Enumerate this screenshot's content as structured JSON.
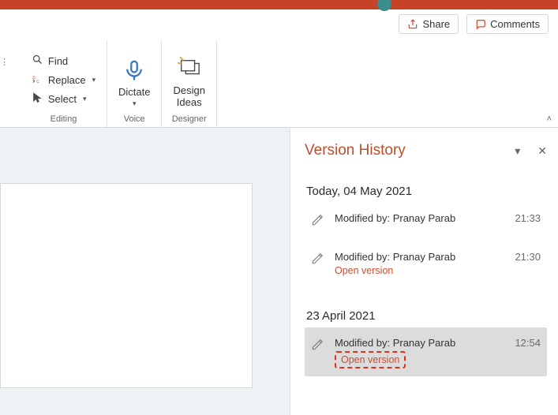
{
  "title_bar": {},
  "top_buttons": {
    "share": "Share",
    "comments": "Comments"
  },
  "ribbon": {
    "editing": {
      "label": "Editing",
      "find": "Find",
      "replace": "Replace",
      "select": "Select"
    },
    "voice": {
      "label": "Voice",
      "dictate": "Dictate"
    },
    "designer": {
      "label": "Designer",
      "button": "Design\nIdeas"
    }
  },
  "pane": {
    "title": "Version History",
    "groups": [
      {
        "label": "Today, 04 May 2021",
        "items": [
          {
            "modified_by": "Modified by: Pranay Parab",
            "time": "21:33"
          },
          {
            "modified_by": "Modified by: Pranay Parab",
            "time": "21:30",
            "open_version": "Open version"
          }
        ]
      },
      {
        "label": "23 April 2021",
        "items": [
          {
            "modified_by": "Modified by: Pranay Parab",
            "time": "12:54",
            "open_version": "Open version",
            "selected": true,
            "highlighted": true
          }
        ]
      }
    ]
  }
}
